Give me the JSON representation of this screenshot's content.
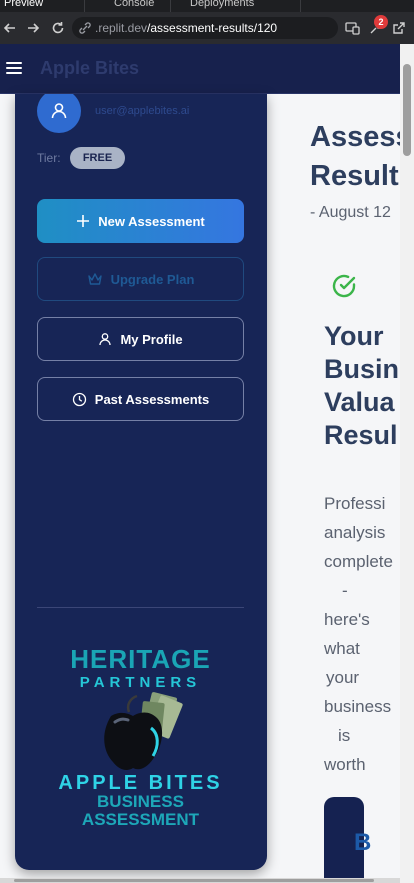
{
  "browser": {
    "tabs": [
      "Preview",
      "Console",
      "Deployments"
    ],
    "url_host": ".replit.dev",
    "url_path": "/assessment-results/120",
    "notification_count": "2"
  },
  "header": {
    "title": "Apple Bites"
  },
  "sidebar": {
    "email": "user@applebites.ai",
    "tier_label": "Tier:",
    "tier_value": "FREE",
    "buttons": {
      "new_assessment": "New Assessment",
      "upgrade_plan": "Upgrade Plan",
      "my_profile": "My Profile",
      "past_assessments": "Past Assessments"
    },
    "logo": {
      "line1": "HERITAGE",
      "line2": "PARTNERS",
      "line3": "APPLE BITES",
      "line4": "BUSINESS",
      "line5": "ASSESSMENT"
    }
  },
  "main": {
    "title_line1": "Assess",
    "title_line2": "Result",
    "date": "- August 12",
    "heading": [
      "Your",
      "Busin",
      "Valua",
      "Resul"
    ],
    "body": [
      "Professi",
      "analysis",
      "complete",
      "-",
      "here's",
      "what",
      "your",
      "business",
      "is",
      "worth"
    ],
    "card_text": "B"
  },
  "colors": {
    "sidebar_bg": "#172556",
    "accent_gradient_start": "#1f8fc4",
    "accent_gradient_end": "#3576e0",
    "success_green": "#3bb54a"
  }
}
